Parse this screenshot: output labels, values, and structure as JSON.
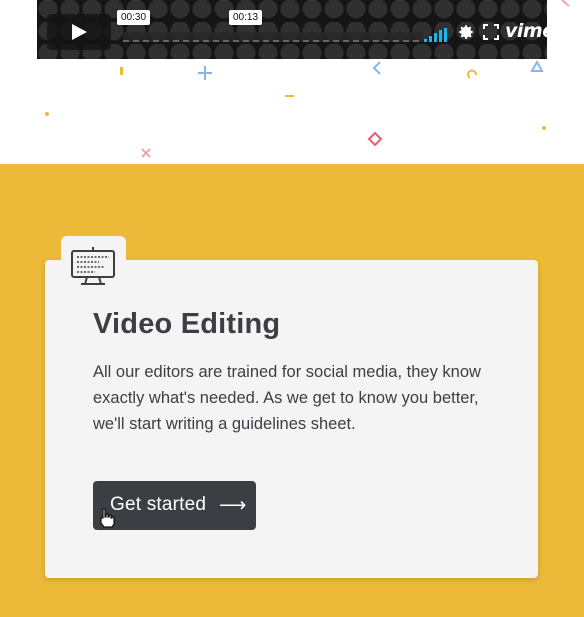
{
  "video": {
    "time_elapsed": "00:30",
    "time_hover": "00:13",
    "brand": "vimeo",
    "icons": [
      "play-icon",
      "volume-icon",
      "gear-icon",
      "fullscreen-icon"
    ]
  },
  "card": {
    "icon": "monitor-editing-icon",
    "title": "Video Editing",
    "text": "All our editors are trained for social media, they know exactly what's needed. As we get to know you better, we'll start writing a guidelines sheet.",
    "cta_label": "Get started",
    "cta_icon": "arrow-right-icon"
  },
  "colors": {
    "section_bg": "#ecba38",
    "card_bg": "#f4f4f4",
    "text": "#3d3e44",
    "button_bg": "#3d3e44",
    "vimeo_accent": "#1ab7ea"
  }
}
